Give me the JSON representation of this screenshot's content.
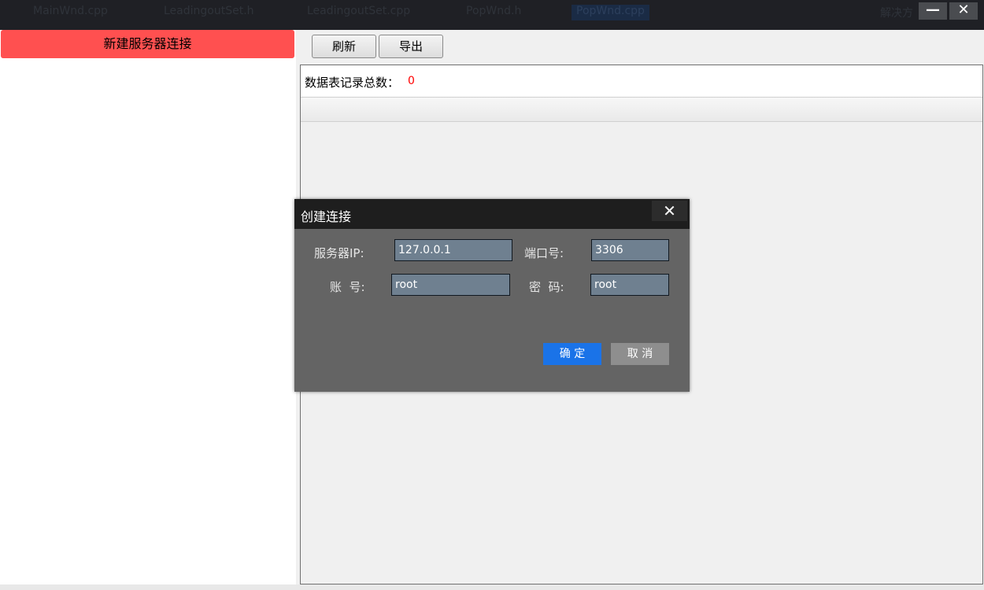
{
  "titlebar": {
    "ghost_tabs": [
      "MainWnd.cpp",
      "LeadingoutSet.h",
      "LeadingoutSet.cpp",
      "PopWnd.h",
      "PopWnd.cpp"
    ],
    "ghost_right": "解决方",
    "minimize_icon": "minimize-icon",
    "close_icon": "close-icon",
    "minimize_glyph": "—",
    "close_glyph": "✕"
  },
  "sidebar": {
    "new_connection_label": "新建服务器连接",
    "accent_color": "#ff5050"
  },
  "toolbar": {
    "refresh_label": "刷新",
    "export_label": "导出"
  },
  "main": {
    "count_label": "数据表记录总数：",
    "count_value": "0",
    "count_color": "#ff0000"
  },
  "dialog": {
    "title": "创建连接",
    "close_glyph": "✕",
    "server_ip_label": "服务器IP:",
    "server_ip_value": "127.0.0.1",
    "port_label": "端口号:",
    "port_value": "3306",
    "account_label": "账  号:",
    "account_value": "root",
    "password_label": "密  码:",
    "password_value": "root",
    "ok_label": "确 定",
    "cancel_label": "取 消",
    "ok_color": "#1a73e8",
    "cancel_color": "#8e8e8e"
  }
}
